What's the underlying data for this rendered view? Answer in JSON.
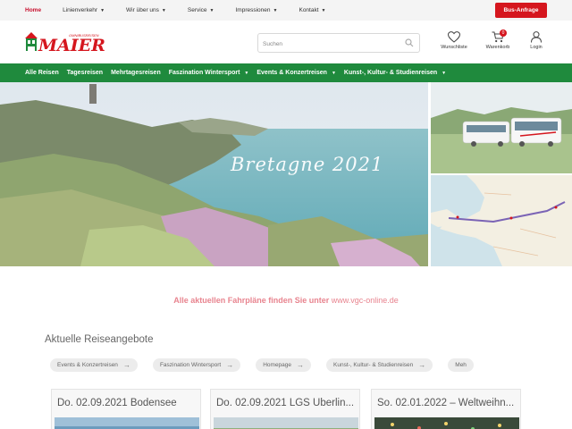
{
  "topnav": {
    "items": [
      {
        "label": "Home",
        "active": true,
        "has_dropdown": false
      },
      {
        "label": "Linienverkehr",
        "has_dropdown": true
      },
      {
        "label": "Wir über uns",
        "has_dropdown": true
      },
      {
        "label": "Service",
        "has_dropdown": true
      },
      {
        "label": "Impressionen",
        "has_dropdown": true
      },
      {
        "label": "Kontakt",
        "has_dropdown": true
      }
    ],
    "bus_button": "Bus-Anfrage",
    "caret": "▼"
  },
  "header": {
    "logo_small": "OMNIBUSREISEN",
    "logo_text": "MAIER",
    "search": {
      "placeholder": "Suchen",
      "value": ""
    },
    "icons": [
      {
        "name": "heart-icon",
        "label": "Wunschliste"
      },
      {
        "name": "cart-icon",
        "label": "Warenkorb",
        "badge": "0"
      },
      {
        "name": "user-icon",
        "label": "Login"
      }
    ]
  },
  "mainnav": {
    "items": [
      {
        "label": "Alle Reisen",
        "has_dropdown": false
      },
      {
        "label": "Tagesreisen",
        "has_dropdown": false
      },
      {
        "label": "Mehrtagesreisen",
        "has_dropdown": false
      },
      {
        "label": "Faszination Wintersport",
        "has_dropdown": true
      },
      {
        "label": "Events & Konzertreisen",
        "has_dropdown": true
      },
      {
        "label": "Kunst-, Kultur- & Studienreisen",
        "has_dropdown": true
      }
    ],
    "caret": "▼"
  },
  "hero": {
    "title": "Bretagne 2021"
  },
  "notice": {
    "text": "Alle aktuellen Fahrpläne finden Sie unter ",
    "link": "www.vgc-online.de"
  },
  "section_title": "Aktuelle Reiseangebote",
  "tags": [
    "Events & Konzertreisen",
    "Faszination Wintersport",
    "Homepage",
    "Kunst-, Kultur- & Studienreisen",
    "Meh"
  ],
  "tag_arrow": "→",
  "cards": [
    {
      "title": "Do. 02.09.2021 Bodensee"
    },
    {
      "title": "Do. 02.09.2021 LGS Überlin..."
    },
    {
      "title": "So. 02.01.2022 – Weltweihn..."
    }
  ],
  "colors": {
    "brand_red": "#d5161e",
    "nav_green": "#1f8a3d",
    "notice_pink": "#e8848f"
  }
}
